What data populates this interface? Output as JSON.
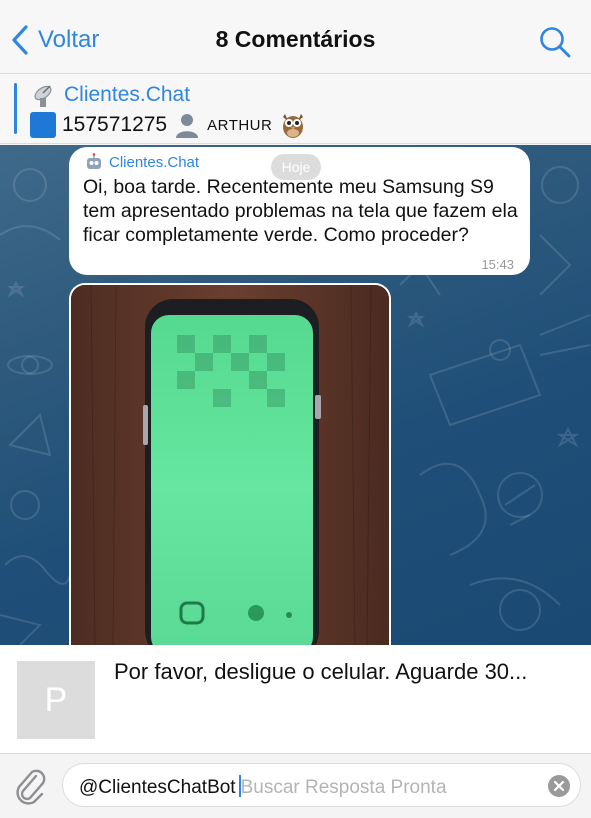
{
  "nav": {
    "back_label": "Voltar",
    "title": "8 Comentários",
    "back_icon": "chevron-left-icon",
    "search_icon": "search-icon"
  },
  "pinned": {
    "name": "Clientes.Chat",
    "number": "157571275",
    "user": "ARTHUR",
    "icons": [
      "satellite-dish-icon",
      "blue-square-icon",
      "user-silhouette-icon",
      "owl-icon"
    ]
  },
  "message": {
    "sender": "Clientes.Chat",
    "sender_icon": "robot-icon",
    "text": "Oi, boa tarde. Recentemente meu Samsung S9 tem apresentado problemas na tela que fazem ela ficar completamente verde. Como proceder?",
    "time": "15:43",
    "date_badge": "Hoje"
  },
  "reply": {
    "thumb_letter": "P",
    "text": "Por favor, desligue o celular. Aguarde 30..."
  },
  "input": {
    "mention": "@ClientesChatBot",
    "placeholder": "Buscar Resposta Pronta",
    "attach_icon": "paperclip-icon",
    "clear_icon": "clear-icon"
  },
  "colors": {
    "accent": "#2f86e0",
    "chat_background": "#2a5a80",
    "screen_green": "#5fe39a"
  }
}
